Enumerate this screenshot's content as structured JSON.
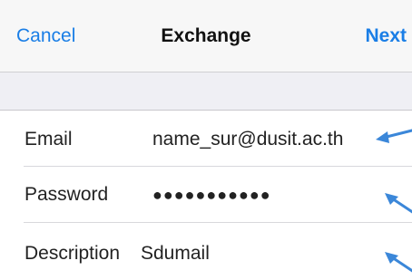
{
  "navbar": {
    "cancel_label": "Cancel",
    "title": "Exchange",
    "next_label": "Next"
  },
  "form": {
    "rows": [
      {
        "label": "Email",
        "value": "name_sur@dusit.ac.th"
      },
      {
        "label": "Password",
        "value": "●●●●●●●●●●●"
      },
      {
        "label": "Description",
        "value": "Sdumail"
      }
    ]
  },
  "annotations": {
    "arrow_icon": "pointer-arrow-icon",
    "arrow_color": "#3b87d9"
  },
  "colors": {
    "accent": "#1a7ee6",
    "nav_background": "#f7f7f7",
    "section_gap": "#efeff4"
  }
}
